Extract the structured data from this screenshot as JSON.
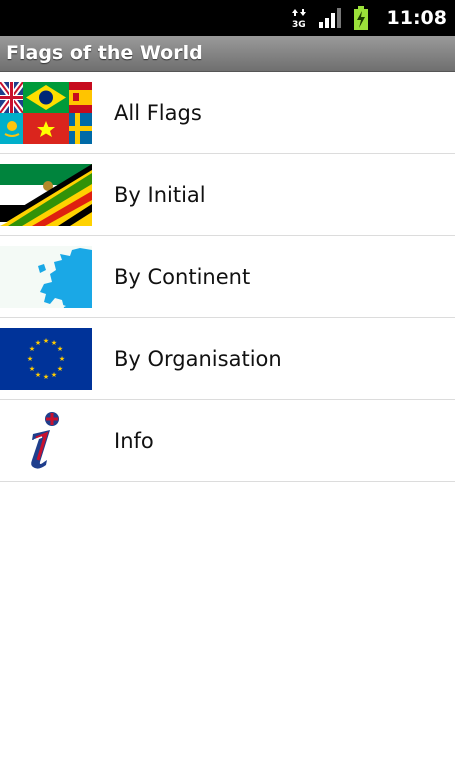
{
  "status_bar": {
    "time": "11:08",
    "icons": [
      "data-3g-icon",
      "signal-icon",
      "battery-charging-icon"
    ]
  },
  "title_bar": {
    "title": "Flags of the World"
  },
  "menu": {
    "items": [
      {
        "label": "All Flags",
        "icon": "flags-collage-icon"
      },
      {
        "label": "By Initial",
        "icon": "diagonal-flags-icon"
      },
      {
        "label": "By Continent",
        "icon": "europe-map-icon"
      },
      {
        "label": "By Organisation",
        "icon": "eu-flag-icon"
      },
      {
        "label": "Info",
        "icon": "info-i-icon"
      }
    ]
  },
  "colors": {
    "title_bar": "#7f7f7f",
    "background": "#ffffff",
    "divider": "#dcdcdc"
  }
}
